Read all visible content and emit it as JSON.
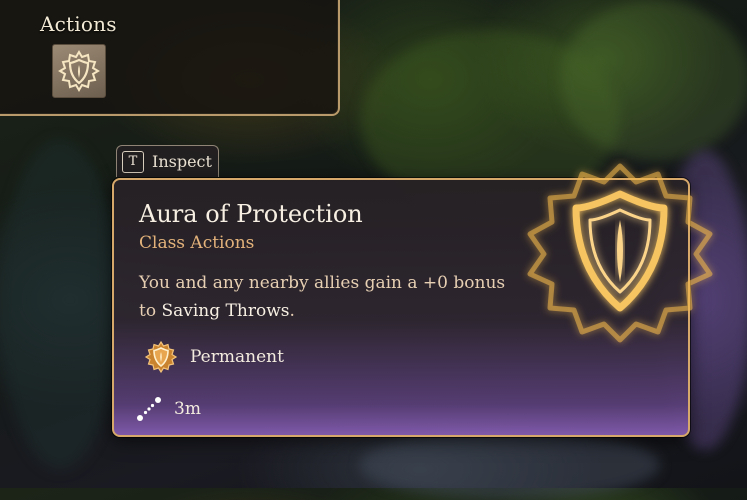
{
  "actions_panel": {
    "title": "Actions",
    "slot_icon": "aura-of-protection-shield-icon"
  },
  "inspect": {
    "key": "T",
    "label": "Inspect"
  },
  "tooltip": {
    "title": "Aura of Protection",
    "subtitle": "Class Actions",
    "description_prefix": "You and any nearby allies gain a +0 bonus to ",
    "description_highlight": "Saving Throws",
    "description_suffix": ".",
    "duration_icon": "shield-emblem-icon",
    "duration": "Permanent",
    "range_icon": "range-dots-icon",
    "range": "3m",
    "emblem_icon": "aura-of-protection-emblem-icon"
  },
  "colors": {
    "tooltip_border": "#d6a86a",
    "subtitle": "#e3b27b",
    "description": "#e6cfb2",
    "rarity_gradient": "#845cb0",
    "emblem_glow": "#f2b84a"
  }
}
